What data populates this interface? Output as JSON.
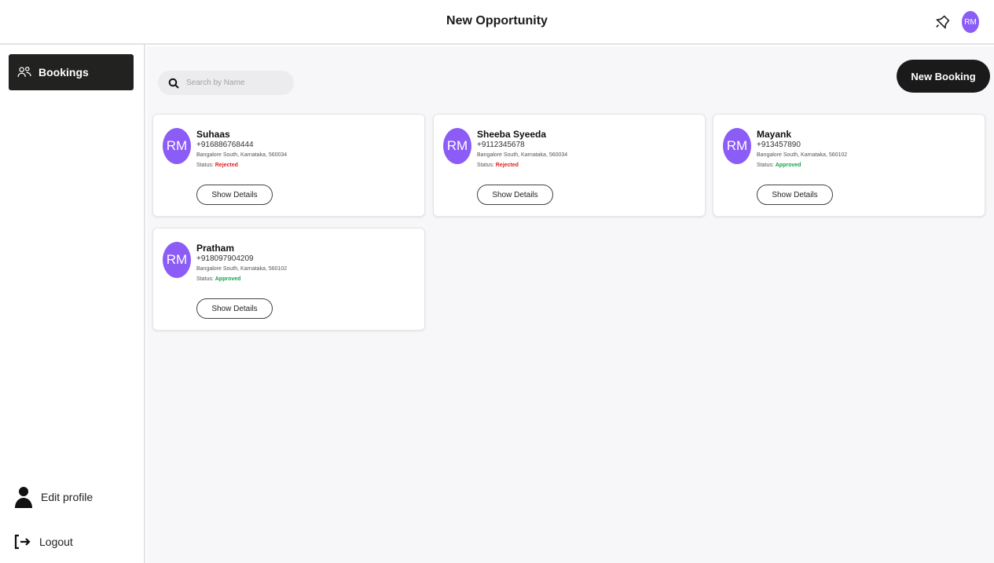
{
  "header": {
    "title": "New Opportunity",
    "avatar_initials": "RM",
    "icon": "bell-icon"
  },
  "sidebar": {
    "bookings_label": "Bookings",
    "edit_profile_label": "Edit profile",
    "logout_label": "Logout"
  },
  "search": {
    "placeholder": "Search by Name"
  },
  "new_booking_label": "New Booking",
  "status_prefix": "Status:",
  "show_details_label": "Show Details",
  "bookings": [
    {
      "initials": "RM",
      "name": "Suhaas",
      "phone": "+916886768444",
      "address": "Bangalore South, Karnataka, 560034",
      "status": "Rejected"
    },
    {
      "initials": "RM",
      "name": "Sheeba Syeeda",
      "phone": "+9112345678",
      "address": "Bangalore South, Karnataka, 560034",
      "status": "Rejected"
    },
    {
      "initials": "RM",
      "name": "Mayank",
      "phone": "+913457890",
      "address": "Bangalore South, Karnataka, 560102",
      "status": "Approved"
    },
    {
      "initials": "RM",
      "name": "Pratham",
      "phone": "+918097904209",
      "address": "Bangalore South, Karnataka, 560102",
      "status": "Approved"
    }
  ],
  "colors": {
    "avatar": "#8b5cf6",
    "rejected": "#e11d1d",
    "approved": "#16a34a",
    "primary": "#1a1a1a"
  }
}
